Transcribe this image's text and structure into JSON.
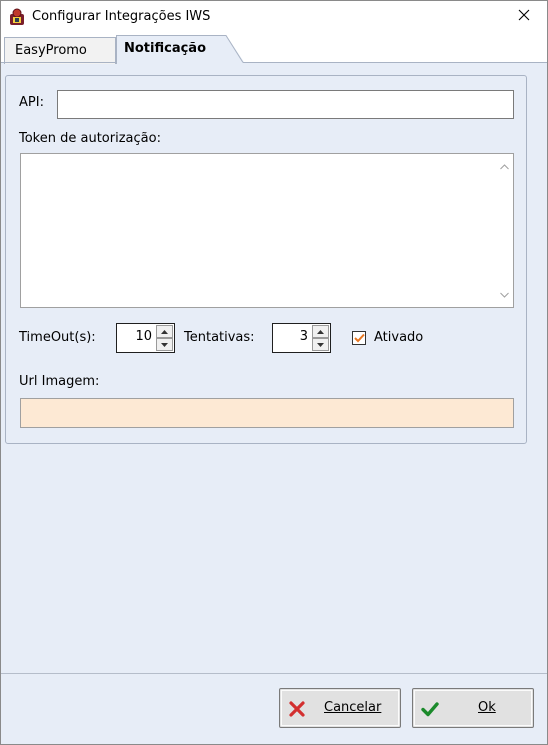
{
  "window": {
    "title": "Configurar Integrações IWS"
  },
  "tabs": [
    {
      "label": "EasyPromo",
      "selected": false
    },
    {
      "label": "Notificação",
      "selected": true
    }
  ],
  "form": {
    "api_label": "API:",
    "api_value": "",
    "token_label": "Token de autorização:",
    "token_value": "",
    "timeout_label": "TimeOut(s):",
    "timeout_value": "10",
    "tentativas_label": "Tentativas:",
    "tentativas_value": "3",
    "ativado_label": "Ativado",
    "ativado_checked": true,
    "url_imagem_label": "Url Imagem:",
    "url_imagem_value": ""
  },
  "buttons": {
    "cancel_label": "Cancelar",
    "ok_label": "Ok"
  },
  "colors": {
    "accent_check": "#e87722",
    "cancel_icon": "#d32f2f",
    "ok_icon": "#1b8a2b",
    "url_field_bg": "#fde9d4"
  },
  "icons": {
    "app": "app-icon",
    "close": "close-icon",
    "cancel": "x-icon",
    "ok": "checkmark-icon"
  }
}
